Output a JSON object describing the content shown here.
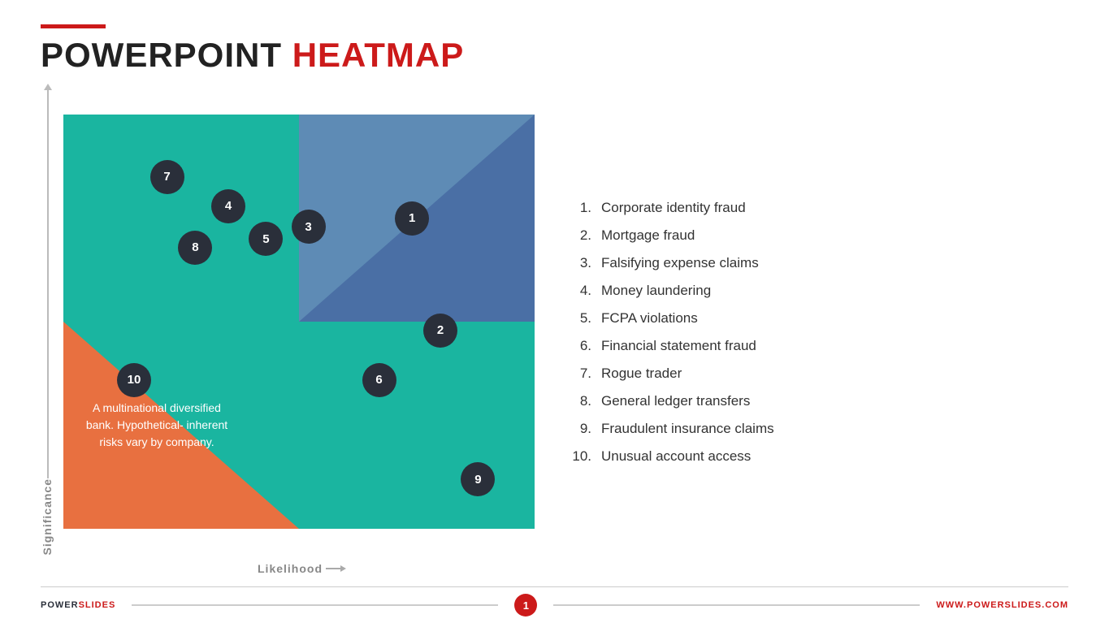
{
  "header": {
    "line_decoration": true,
    "title_part1": "POWERPOINT ",
    "title_part2": "HEATMAP"
  },
  "chart": {
    "y_axis_label": "Significance",
    "x_axis_label": "Likelihood",
    "description": "A multinational diversified bank. Hypothetical- inherent risks vary by company.",
    "bubbles": [
      {
        "id": 1,
        "label": "1",
        "left_pct": 74,
        "top_pct": 25
      },
      {
        "id": 2,
        "label": "2",
        "left_pct": 80,
        "top_pct": 52
      },
      {
        "id": 3,
        "label": "3",
        "left_pct": 52,
        "top_pct": 27
      },
      {
        "id": 4,
        "label": "4",
        "left_pct": 35,
        "top_pct": 22
      },
      {
        "id": 5,
        "label": "5",
        "left_pct": 43,
        "top_pct": 30
      },
      {
        "id": 6,
        "label": "6",
        "left_pct": 67,
        "top_pct": 64
      },
      {
        "id": 7,
        "label": "7",
        "left_pct": 22,
        "top_pct": 15
      },
      {
        "id": 8,
        "label": "8",
        "left_pct": 28,
        "top_pct": 32
      },
      {
        "id": 9,
        "label": "9",
        "left_pct": 88,
        "top_pct": 88
      },
      {
        "id": 10,
        "label": "10",
        "left_pct": 15,
        "top_pct": 64
      }
    ]
  },
  "legend": {
    "items": [
      {
        "number": "1.",
        "text": "Corporate identity fraud"
      },
      {
        "number": "2.",
        "text": "Mortgage fraud"
      },
      {
        "number": "3.",
        "text": "Falsifying expense claims"
      },
      {
        "number": "4.",
        "text": "Money laundering"
      },
      {
        "number": "5.",
        "text": "FCPA violations"
      },
      {
        "number": "6.",
        "text": "Financial statement fraud"
      },
      {
        "number": "7.",
        "text": "Rogue trader"
      },
      {
        "number": "8.",
        "text": "General ledger transfers"
      },
      {
        "number": "9.",
        "text": "Fraudulent insurance claims"
      },
      {
        "number": "10.",
        "text": "Unusual account access"
      }
    ]
  },
  "footer": {
    "brand_part1": "POWER",
    "brand_part2": "SLIDES",
    "page_number": "1",
    "website": "WWW.POWERSLIDES.COM"
  }
}
